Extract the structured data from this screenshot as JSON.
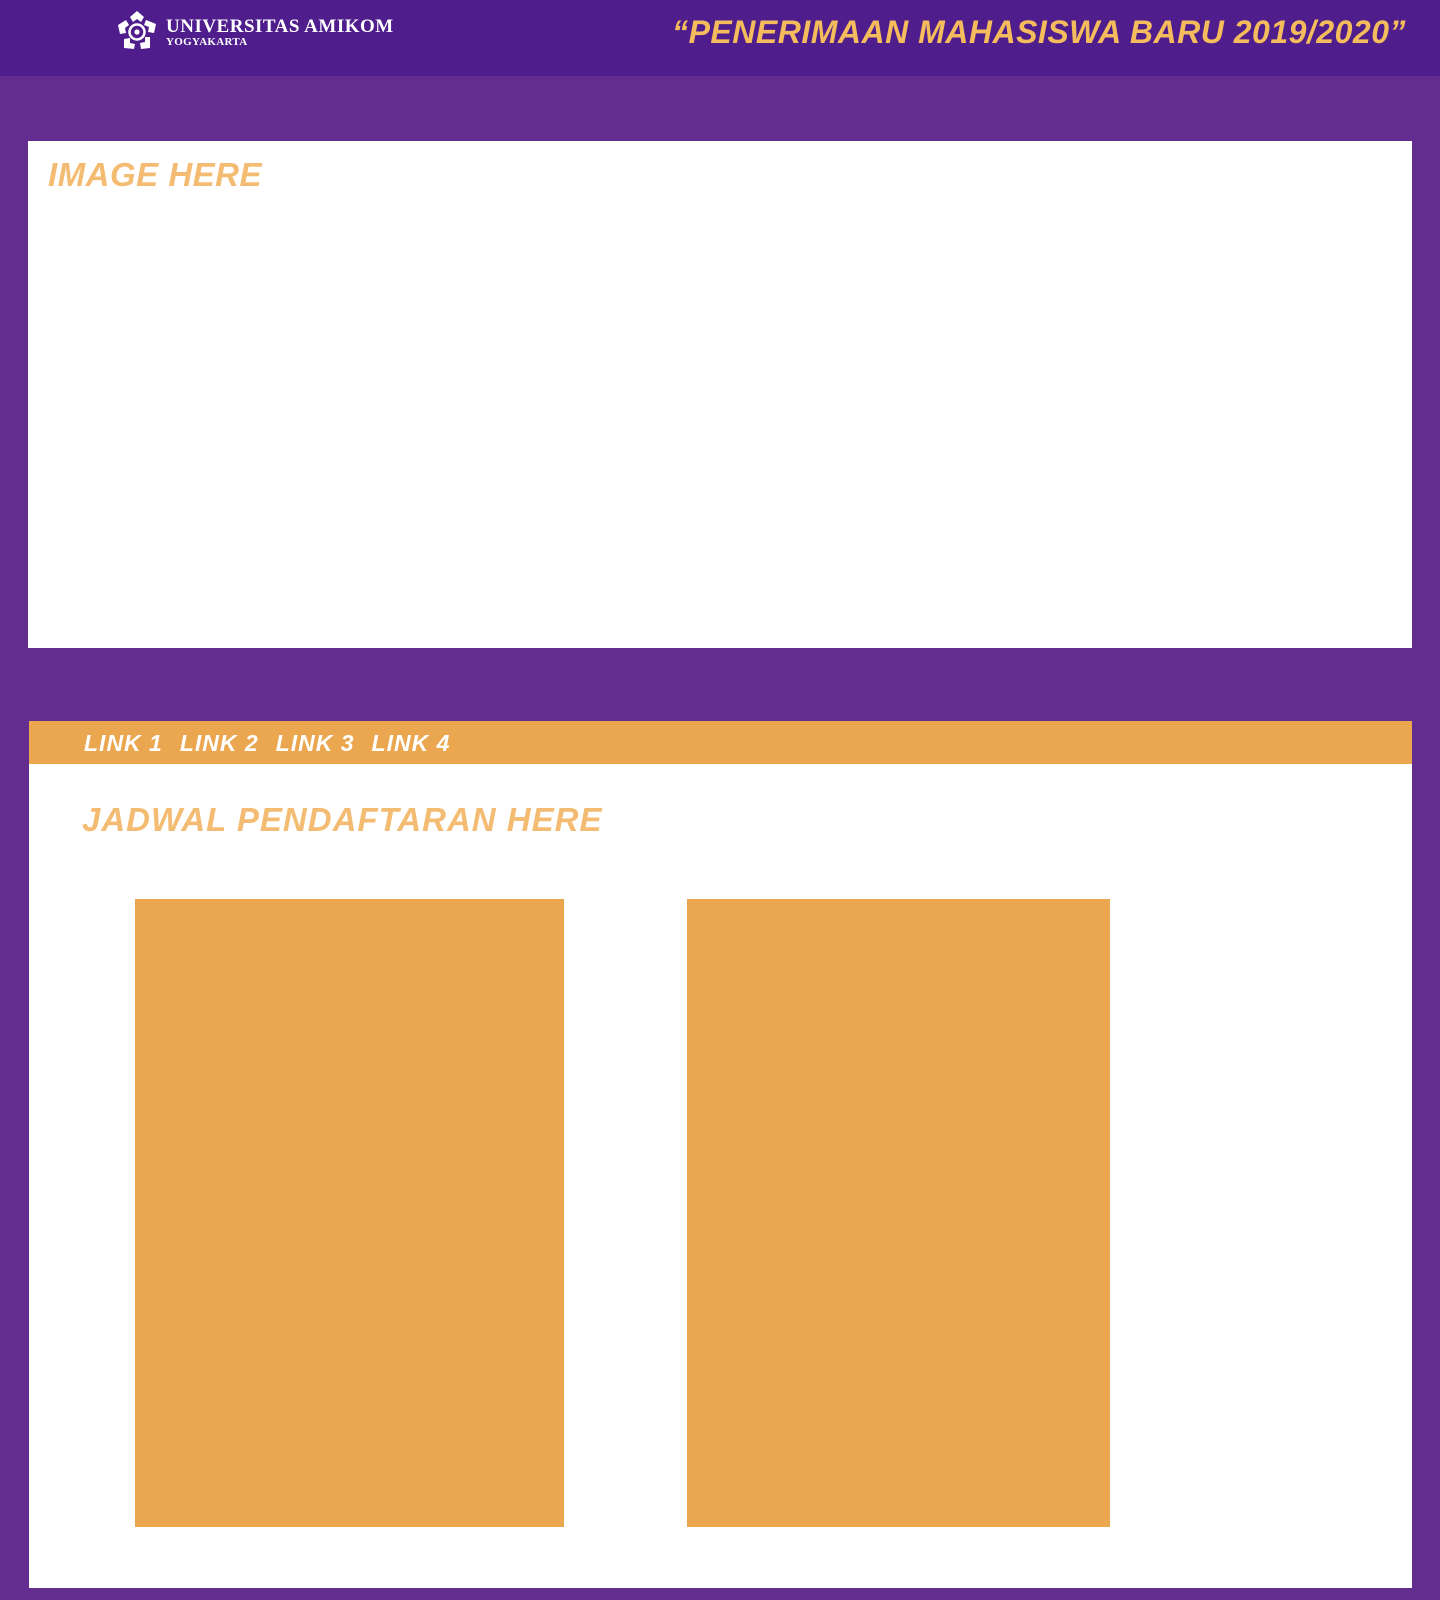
{
  "header": {
    "logo": {
      "name": "UNIVERSITAS AMIKOM",
      "city": "YOGYAKARTA",
      "icon": "amikom-emblem-icon"
    },
    "headline": "“PENERIMAAN MAHASISWA BARU 2019/2020”"
  },
  "hero": {
    "label": "IMAGE HERE"
  },
  "nav": {
    "links": [
      {
        "label": "LINK 1"
      },
      {
        "label": "LINK 2"
      },
      {
        "label": "LINK 3"
      },
      {
        "label": "LINK 4"
      }
    ]
  },
  "schedule": {
    "title": "JADWAL PENDAFTARAN HERE"
  },
  "colors": {
    "header_bg": "#4f1e8c",
    "page_bg": "#632d8f",
    "accent_orange": "#eba74f",
    "headline_yellow": "#f4bc5c",
    "label_orange": "#f4bc72"
  }
}
